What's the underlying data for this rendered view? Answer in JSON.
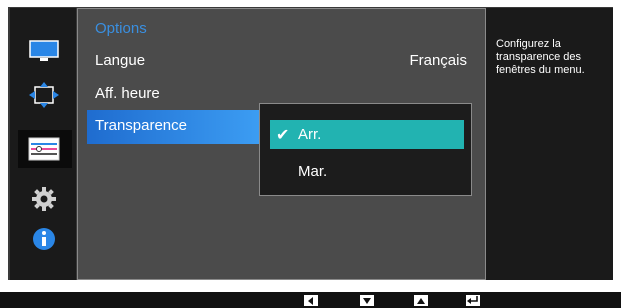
{
  "menu": {
    "title": "Options",
    "items": [
      {
        "label": "Langue",
        "value": "Français"
      },
      {
        "label": "Aff. heure",
        "value": ""
      },
      {
        "label": "Transparence",
        "value": ""
      }
    ]
  },
  "dropdown": {
    "options": [
      {
        "label": "Arr.",
        "selected": true
      },
      {
        "label": "Mar.",
        "selected": false
      }
    ]
  },
  "help": {
    "text": "Configurez la transparence des fenêtres du menu."
  },
  "sidebar": {
    "icons": [
      "monitor-icon",
      "resize-arrows-icon",
      "sliders-icon",
      "gear-icon",
      "info-icon"
    ],
    "selected": "sliders-icon"
  },
  "navbar": {
    "buttons": [
      "left-arrow-icon",
      "down-arrow-icon",
      "up-arrow-icon",
      "return-icon"
    ]
  },
  "colors": {
    "accent_blue": "#2f86e6",
    "option_highlight": "#22b3b1",
    "title_blue": "#3a8fe0"
  }
}
